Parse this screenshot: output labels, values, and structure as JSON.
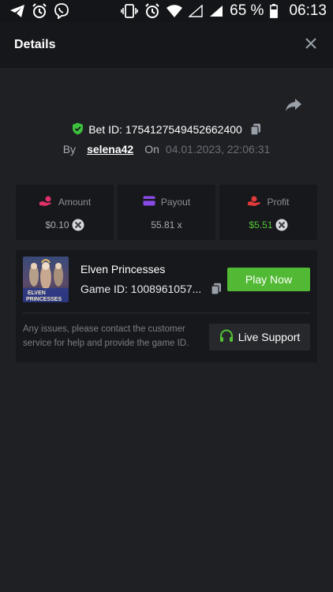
{
  "status_bar": {
    "battery_percent": "65 %",
    "time": "06:13"
  },
  "header": {
    "title": "Details"
  },
  "bet": {
    "bet_id_label": "Bet ID: 1754127549452662400",
    "by_label": "By",
    "username": "selena42",
    "on_label": "On",
    "date": "04.01.2023, 22:06:31"
  },
  "stats": {
    "amount": {
      "label": "Amount",
      "value": "$0.10"
    },
    "payout": {
      "label": "Payout",
      "value": "55.81 x"
    },
    "profit": {
      "label": "Profit",
      "value": "$5.51"
    }
  },
  "game": {
    "title": "Elven Princesses",
    "game_id": "Game ID: 1008961057...",
    "thumb_text_1": "ELVEN",
    "thumb_text_2": "PRINCESSES",
    "play_label": "Play Now"
  },
  "support": {
    "text": "Any issues, please contact the customer service for help and provide the game ID.",
    "button_label": "Live Support"
  },
  "colors": {
    "background": "#1f2024",
    "header": "#16171a",
    "card": "#17181b",
    "accent_green": "#52b934",
    "profit_green": "#56c33a",
    "amount_icon": "#e0306a",
    "payout_icon": "#8a4ae8",
    "profit_icon": "#e03a3a",
    "shield_green": "#3cc13c"
  }
}
